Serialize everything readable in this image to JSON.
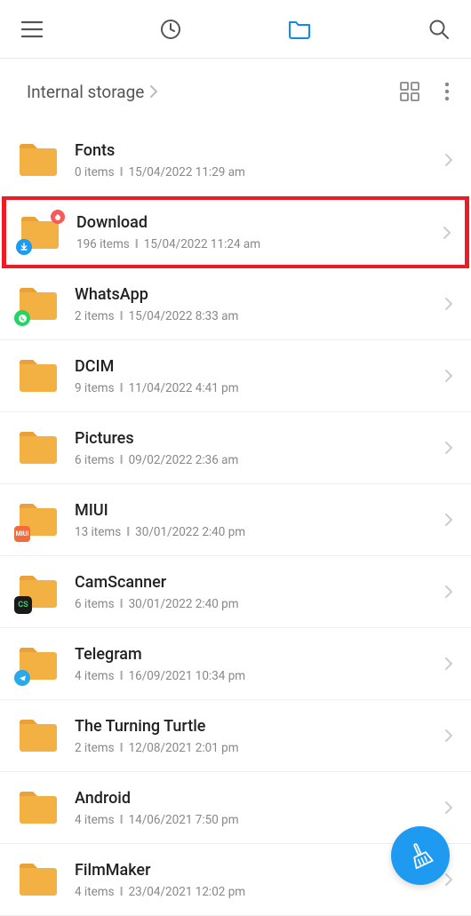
{
  "breadcrumb": {
    "label": "Internal storage"
  },
  "folders": [
    {
      "name": "Fonts",
      "items": "0 items",
      "date": "15/04/2022 11:29 am",
      "badge": null,
      "highlighted": false
    },
    {
      "name": "Download",
      "items": "196 items",
      "date": "15/04/2022 11:24 am",
      "badge": "download",
      "highlighted": true
    },
    {
      "name": "WhatsApp",
      "items": "2 items",
      "date": "15/04/2022 8:33 am",
      "badge": "whatsapp",
      "highlighted": false
    },
    {
      "name": "DCIM",
      "items": "9 items",
      "date": "11/04/2022 4:41 pm",
      "badge": null,
      "highlighted": false
    },
    {
      "name": "Pictures",
      "items": "6 items",
      "date": "09/02/2022 2:36 am",
      "badge": null,
      "highlighted": false
    },
    {
      "name": "MIUI",
      "items": "13 items",
      "date": "30/01/2022 2:40 pm",
      "badge": "miui",
      "highlighted": false
    },
    {
      "name": "CamScanner",
      "items": "6 items",
      "date": "30/01/2022 2:40 pm",
      "badge": "camscanner",
      "highlighted": false
    },
    {
      "name": "Telegram",
      "items": "4 items",
      "date": "16/09/2021 10:34 pm",
      "badge": "telegram",
      "highlighted": false
    },
    {
      "name": "The Turning Turtle",
      "items": "2 items",
      "date": "12/08/2021 2:01 pm",
      "badge": null,
      "highlighted": false
    },
    {
      "name": "Android",
      "items": "4 items",
      "date": "14/06/2021 7:50 pm",
      "badge": null,
      "highlighted": false
    },
    {
      "name": "FilmMaker",
      "items": "4 items",
      "date": "23/04/2021 12:02 pm",
      "badge": null,
      "highlighted": false
    }
  ],
  "colors": {
    "folder": "#f3b144",
    "highlight": "#eb1c26",
    "fab": "#1e9bf0",
    "active_icon": "#0d8cf0"
  }
}
